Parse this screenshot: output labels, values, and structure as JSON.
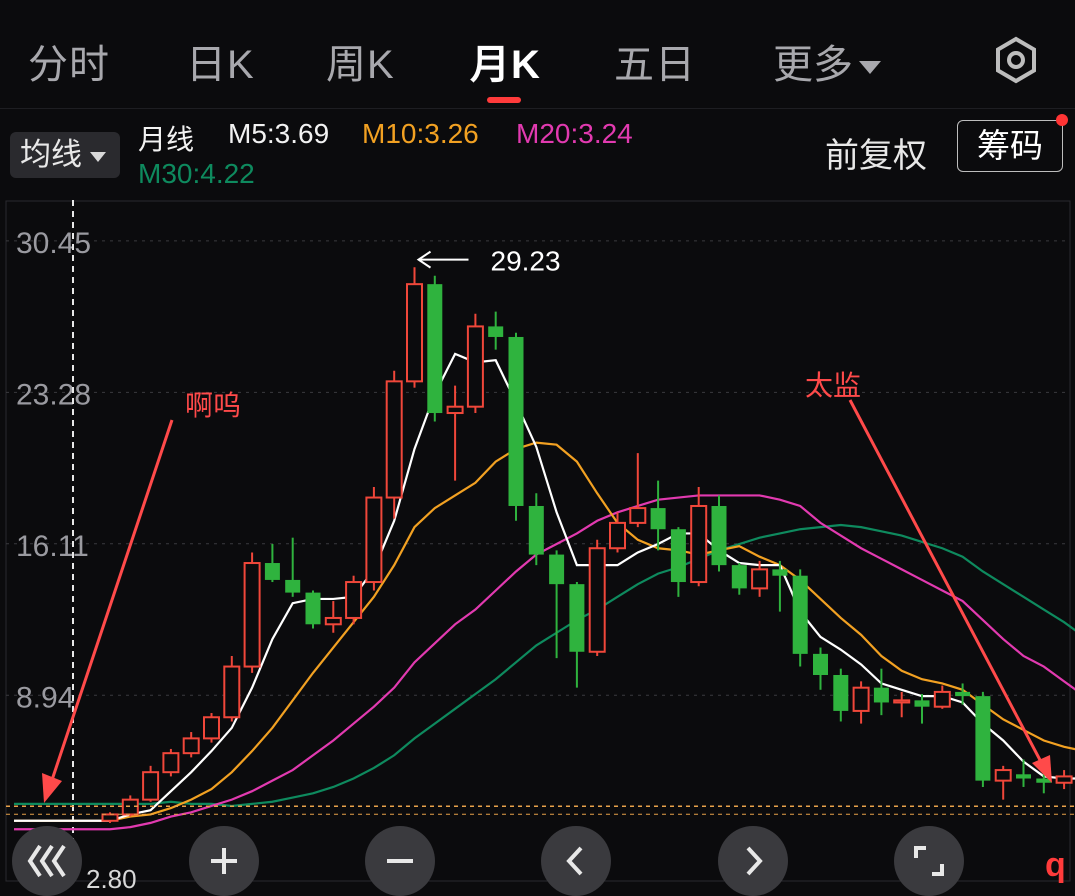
{
  "tabs": [
    {
      "label": "分时"
    },
    {
      "label": "日K"
    },
    {
      "label": "周K"
    },
    {
      "label": "月K"
    },
    {
      "label": "五日"
    }
  ],
  "active_tab": "月K",
  "more_label": "更多",
  "ma_dropdown_label": "均线",
  "period_label": "月线",
  "ma": {
    "m5": "M5:3.69",
    "m10": "M10:3.26",
    "m20": "M20:3.24",
    "m30": "M30:4.22"
  },
  "adjust_label": "前复权",
  "chips_label": "筹码",
  "colors": {
    "up": "#f0473a",
    "down": "#2fb33e",
    "m5": "#ffffff",
    "m10": "#f2a122",
    "m20": "#e23ab0",
    "m30": "#0e8a5e",
    "annotation": "#ff4a4a",
    "active_tab_indicator": "#ff3b3b"
  },
  "icons": [
    "settings-hex-icon",
    "rewind-icon",
    "zoom-in-icon",
    "zoom-out-icon",
    "prev-icon",
    "next-icon",
    "fullscreen-icon"
  ],
  "annotations": {
    "peak_value": "29.23",
    "left_note": "啊呜",
    "right_note": "太监"
  },
  "bottom_price": "2.80",
  "corner_label": "q",
  "chart_data": {
    "type": "candlestick",
    "title": "",
    "y_ticks": [
      "30.45",
      "23.28",
      "16.11",
      "8.94"
    ],
    "y_tick_values": [
      30.45,
      23.28,
      16.11,
      8.94
    ],
    "ylim": [
      2.8,
      31.2
    ],
    "current_price_line": 3.69,
    "peak": 29.23,
    "candles": [
      [
        3.0,
        3.4,
        2.9,
        3.3
      ],
      [
        3.3,
        4.2,
        3.2,
        4.0
      ],
      [
        4.0,
        5.6,
        3.9,
        5.3
      ],
      [
        5.3,
        6.4,
        5.1,
        6.2
      ],
      [
        6.2,
        7.2,
        6.0,
        6.9
      ],
      [
        6.9,
        8.1,
        6.7,
        7.9
      ],
      [
        7.9,
        10.8,
        7.7,
        10.3
      ],
      [
        10.3,
        15.7,
        10.0,
        15.2
      ],
      [
        15.2,
        16.1,
        14.3,
        14.4
      ],
      [
        14.4,
        16.4,
        13.6,
        13.8
      ],
      [
        13.8,
        13.9,
        12.1,
        12.3
      ],
      [
        12.3,
        13.4,
        11.9,
        12.6
      ],
      [
        12.6,
        14.6,
        12.3,
        14.3
      ],
      [
        14.3,
        18.8,
        13.9,
        18.3
      ],
      [
        18.3,
        24.3,
        17.3,
        23.8
      ],
      [
        23.8,
        29.2,
        23.5,
        28.4
      ],
      [
        28.4,
        28.8,
        21.9,
        22.3
      ],
      [
        22.3,
        23.6,
        19.1,
        22.6
      ],
      [
        22.6,
        27.0,
        22.3,
        26.4
      ],
      [
        26.4,
        27.1,
        25.3,
        25.9
      ],
      [
        25.9,
        26.1,
        17.2,
        17.9
      ],
      [
        17.9,
        18.5,
        15.1,
        15.6
      ],
      [
        15.6,
        15.8,
        10.7,
        14.2
      ],
      [
        14.2,
        14.3,
        9.3,
        11.0
      ],
      [
        11.0,
        16.3,
        10.8,
        15.9
      ],
      [
        15.9,
        17.6,
        15.7,
        17.1
      ],
      [
        17.1,
        20.4,
        16.9,
        17.8
      ],
      [
        17.8,
        19.1,
        15.8,
        16.8
      ],
      [
        16.8,
        16.9,
        13.6,
        14.3
      ],
      [
        14.3,
        18.8,
        14.1,
        17.9
      ],
      [
        17.9,
        18.4,
        14.8,
        15.1
      ],
      [
        15.1,
        15.2,
        13.7,
        14.0
      ],
      [
        14.0,
        15.3,
        13.6,
        14.9
      ],
      [
        14.9,
        15.3,
        12.9,
        14.6
      ],
      [
        14.6,
        14.9,
        10.3,
        10.9
      ],
      [
        10.9,
        11.2,
        9.2,
        9.9
      ],
      [
        9.9,
        10.2,
        7.7,
        8.2
      ],
      [
        8.2,
        9.6,
        7.6,
        9.3
      ],
      [
        9.3,
        10.2,
        8.0,
        8.6
      ],
      [
        8.6,
        9.1,
        7.9,
        8.7
      ],
      [
        8.7,
        9.0,
        7.6,
        8.4
      ],
      [
        8.4,
        9.4,
        8.3,
        9.1
      ],
      [
        9.1,
        9.5,
        8.5,
        8.9
      ],
      [
        8.9,
        9.1,
        4.6,
        4.9
      ],
      [
        4.9,
        5.6,
        4.0,
        5.4
      ],
      [
        5.2,
        5.9,
        4.6,
        5.0
      ],
      [
        5.0,
        5.3,
        4.3,
        4.8
      ],
      [
        4.8,
        5.4,
        4.5,
        5.1
      ],
      [
        5.1,
        5.2,
        4.5,
        4.6
      ]
    ],
    "series": [
      {
        "name": "M5",
        "values": [
          3.0,
          3.3,
          3.5,
          4.4,
          5.3,
          6.3,
          7.4,
          9.3,
          11.6,
          13.3,
          13.5,
          13.5,
          13.6,
          14.9,
          17.2,
          20.6,
          23.2,
          25.1,
          24.7,
          24.8,
          22.8,
          20.7,
          17.6,
          15.1,
          15.1,
          15.1,
          15.7,
          16.1,
          16.6,
          16.6,
          15.8,
          15.2,
          15.1,
          15.1,
          12.9,
          11.7,
          11.1,
          10.4,
          9.5,
          9.2,
          8.9,
          8.9,
          8.6,
          7.6,
          6.8,
          5.8,
          5.1,
          5.0,
          5.0
        ]
      },
      {
        "name": "M10",
        "values": [
          3.0,
          3.2,
          3.3,
          3.6,
          4.0,
          4.5,
          5.3,
          6.3,
          7.4,
          8.7,
          10.0,
          11.2,
          12.4,
          13.6,
          15.1,
          16.9,
          17.8,
          18.4,
          19.0,
          20.0,
          20.6,
          20.9,
          20.8,
          20.0,
          18.5,
          17.1,
          16.3,
          15.9,
          15.8,
          15.6,
          15.8,
          16.0,
          15.5,
          15.1,
          14.4,
          13.5,
          12.6,
          11.8,
          10.8,
          10.1,
          9.7,
          9.5,
          9.2,
          8.5,
          7.8,
          7.3,
          6.8,
          6.5,
          6.3
        ]
      },
      {
        "name": "M20",
        "values": [
          2.6,
          2.7,
          2.9,
          3.2,
          3.4,
          3.7,
          4.0,
          4.4,
          4.9,
          5.4,
          6.1,
          6.8,
          7.6,
          8.4,
          9.3,
          10.5,
          11.4,
          12.3,
          13.0,
          13.9,
          14.8,
          15.6,
          16.1,
          16.6,
          17.2,
          17.6,
          17.9,
          18.2,
          18.3,
          18.4,
          18.4,
          18.4,
          18.4,
          18.2,
          17.9,
          17.1,
          16.5,
          15.9,
          15.4,
          14.9,
          14.4,
          13.9,
          13.4,
          12.5,
          11.6,
          10.8,
          10.3,
          9.6,
          8.9
        ]
      },
      {
        "name": "M30",
        "values": [
          3.8,
          3.8,
          3.8,
          3.9,
          3.8,
          3.8,
          3.7,
          3.8,
          3.9,
          4.1,
          4.3,
          4.6,
          5.0,
          5.5,
          6.1,
          6.9,
          7.6,
          8.3,
          9.0,
          9.7,
          10.5,
          11.3,
          11.9,
          12.5,
          13.0,
          13.6,
          14.2,
          14.7,
          15.0,
          15.4,
          15.8,
          16.1,
          16.4,
          16.6,
          16.8,
          16.9,
          17.0,
          16.9,
          16.7,
          16.5,
          16.2,
          15.9,
          15.5,
          14.8,
          14.2,
          13.6,
          13.0,
          12.4,
          11.7
        ]
      }
    ]
  }
}
